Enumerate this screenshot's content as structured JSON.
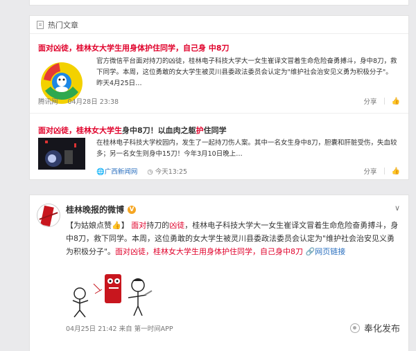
{
  "hot": {
    "header": "热门文章",
    "a1": {
      "title_red": "面对凶徒，桂林女大学生用身体护住同学，自己身 中8刀",
      "summary": "官方微信平台面对持刀的凶徒，桂林电子科技大学大一女生崔译文冒着生命危险奋勇搏斗，身中8刀，救下同学。本周，这位勇敢的女大学生被灵川县委政法委员会认定为\"维护社会治安见义勇为积极分子\"。昨天4月25日…",
      "source": "腾讯网",
      "time": "04月28日 23:38",
      "share": "分享"
    },
    "a2": {
      "title_red": "面对凶徒，桂林女大学生",
      "title_dark": "身中8刀！以血肉之躯",
      "title_red2": "护",
      "title_dark2": "住同学",
      "summary": "在桂林电子科技大学校园内，发生了一起持刀伤人案。其中一名女生身中8刀，胆囊和肝脏受伤，失血较多；另一名女生则身中15刀！今年3月10日晚上…",
      "source": "广西新闻网",
      "time": "今天13:25",
      "share": "分享"
    }
  },
  "post": {
    "author": "桂林晚报的微博",
    "badge": "V",
    "text_p1": "【为姑娘点赞",
    "text_p2": "】",
    "text_red1": "面对",
    "text_p3": "持刀的",
    "text_red2": "凶徒",
    "text_p4": "，桂林电子科技大学大一女生崔译文冒着生命危险奋勇搏斗，身中8刀，救下同学。本周，这位勇敢的女大学生被灵川县委政法委员会认定为\"维护社会治安见义勇为积极分子\"。",
    "text_red3": "面对凶徒，桂林女大学生用身体护住同学，自己身中8刀",
    "link": "网页链接",
    "meta": "04月25日 21:42 来自 第一时间APP",
    "watermark": "奉化发布"
  },
  "colors": {
    "accent_red": "#e0002a",
    "highlight_pink": "#d4237a",
    "link_blue": "#2a6fbf"
  },
  "icons": [
    "document-icon",
    "thumbs-up-icon",
    "globe-icon",
    "chevron-down-icon",
    "clap-emoji",
    "link-icon",
    "wechat-watermark-icon"
  ]
}
